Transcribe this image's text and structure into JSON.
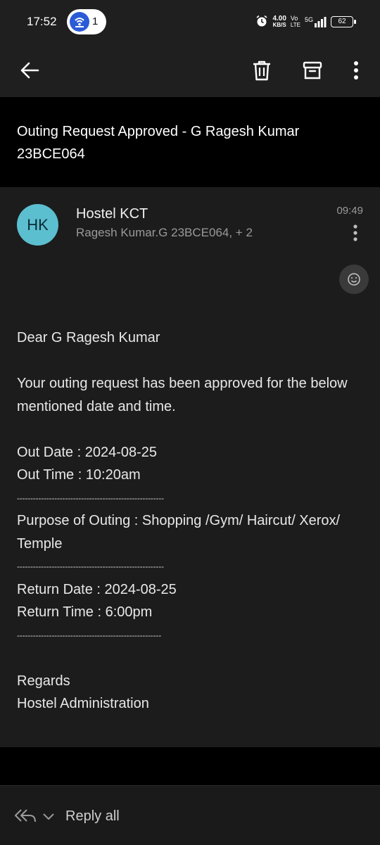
{
  "status_bar": {
    "time": "17:52",
    "notification_count": "1",
    "net_speed_value": "4.00",
    "net_speed_unit": "KB/S",
    "volte_top": "Vo",
    "volte_bottom": "LTE",
    "network": "5G",
    "battery": "62"
  },
  "toolbar": {
    "back_icon": "arrow-left-icon",
    "delete_icon": "trash-icon",
    "archive_icon": "archive-icon",
    "more_icon": "more-vertical-icon"
  },
  "email": {
    "subject": "Outing Request Approved - G Ragesh Kumar 23BCE064",
    "avatar_initials": "HK",
    "avatar_color": "#5bbfd0",
    "sender": "Hostel KCT",
    "recipients": "Ragesh Kumar.G 23BCE064, + 2",
    "time": "09:49",
    "body": {
      "greeting": "Dear G Ragesh Kumar",
      "intro": "Your outing request has been approved for the below mentioned date and time.",
      "out_date": "Out Date : 2024-08-25",
      "out_time": "Out Time : 10:20am",
      "divider1": "-------------------------------------------------------",
      "purpose": "Purpose of Outing : Shopping /Gym/ Haircut/ Xerox/ Temple",
      "divider2": "-------------------------------------------------------",
      "return_date": "Return Date : 2024-08-25",
      "return_time": "Return Time : 6:00pm",
      "divider3": "------------------------------------------------------",
      "regards": "Regards",
      "signature": "Hostel Administration"
    }
  },
  "bottom_bar": {
    "reply_label": "Reply all"
  }
}
